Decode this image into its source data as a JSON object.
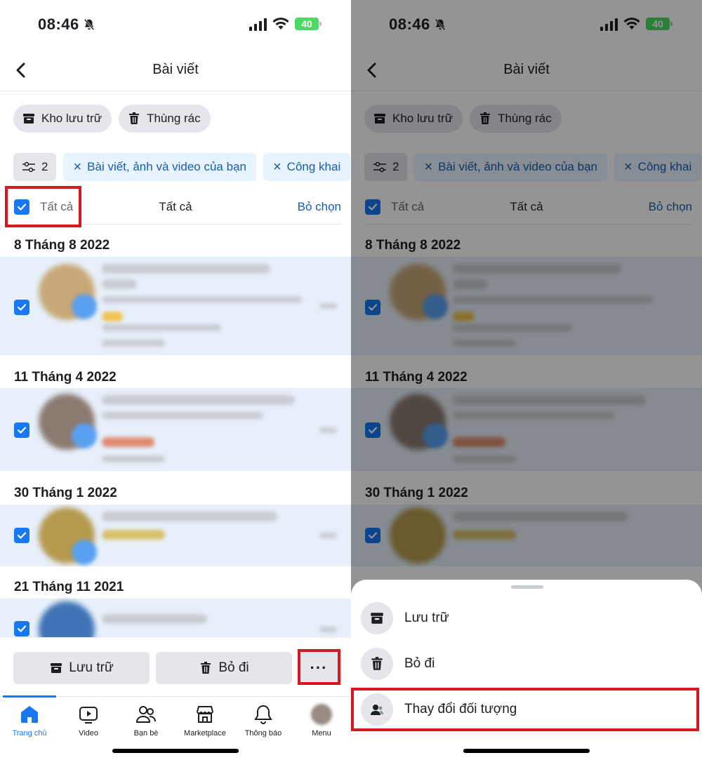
{
  "status": {
    "time": "08:46",
    "battery": "40"
  },
  "header": {
    "title": "Bài viết"
  },
  "chips": {
    "archive": "Kho lưu trữ",
    "trash": "Thùng rác"
  },
  "filters": {
    "count": "2",
    "posts": "Bài viết, ảnh và video của bạn",
    "public": "Công khai"
  },
  "select_row": {
    "all_label": "Tất cả",
    "center": "Tất cả",
    "unselect": "Bỏ chọn"
  },
  "dates": [
    "8 Tháng 8 2022",
    "11 Tháng 4 2022",
    "30 Tháng 1 2022",
    "21 Tháng 11 2021"
  ],
  "actions": {
    "archive": "Lưu trữ",
    "remove": "Bỏ đi",
    "more": "···"
  },
  "tabs": [
    {
      "label": "Trang chủ"
    },
    {
      "label": "Video"
    },
    {
      "label": "Bạn bè"
    },
    {
      "label": "Marketplace"
    },
    {
      "label": "Thông báo"
    },
    {
      "label": "Menu"
    }
  ],
  "sheet": {
    "items": [
      {
        "label": "Lưu trữ"
      },
      {
        "label": "Bỏ đi"
      },
      {
        "label": "Thay đổi đối tượng"
      }
    ]
  },
  "colors": {
    "accent": "#1877f2",
    "highlight": "#d7181f",
    "selected_row": "#e7f0fa"
  }
}
